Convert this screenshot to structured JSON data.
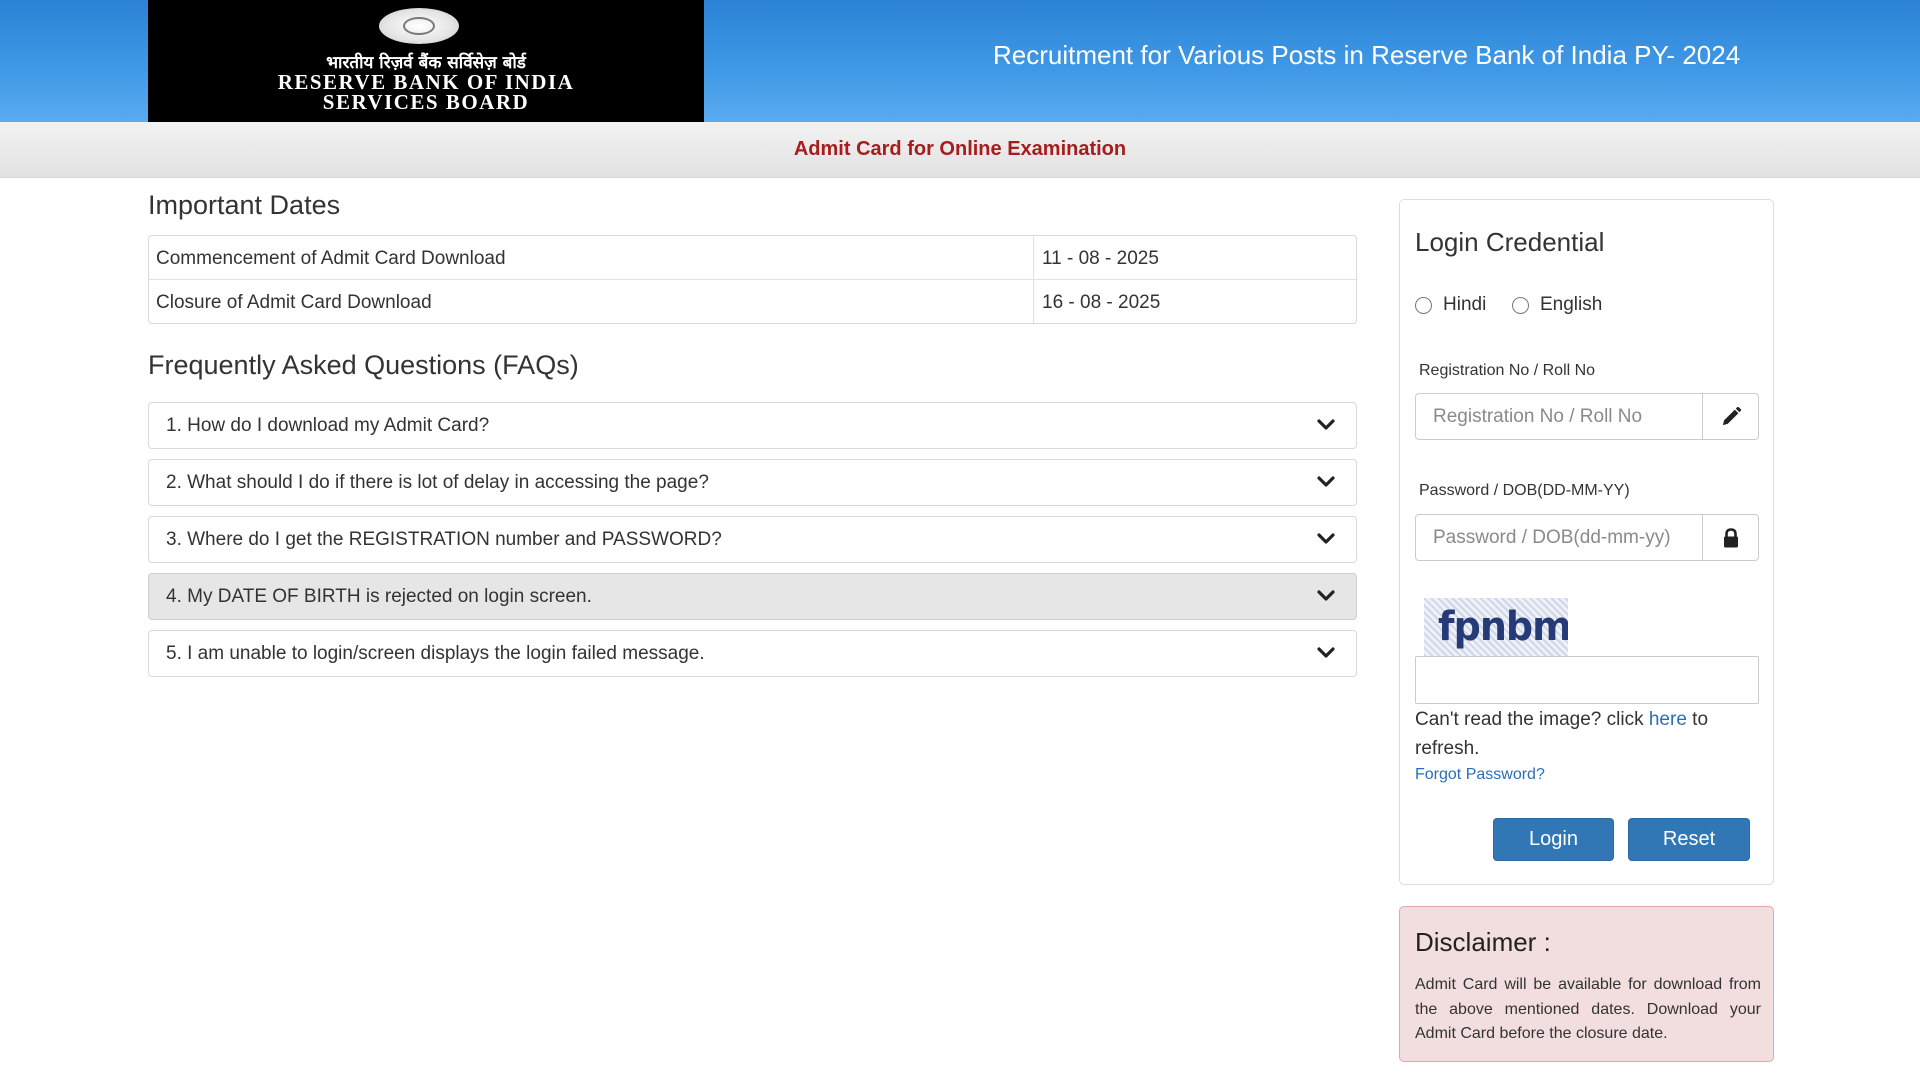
{
  "header": {
    "logo_hindi": "भारतीय रिज़र्व बैंक सर्विसेज़ बोर्ड",
    "logo_line1": "RESERVE BANK OF INDIA",
    "logo_line2": "SERVICES BOARD",
    "title": "Recruitment for Various Posts in Reserve Bank of India PY- 2024",
    "colors": {
      "header_blue": "#3f98e5",
      "logo_bg": "#000000"
    }
  },
  "subheader": {
    "title": "Admit Card for Online Examination",
    "color": "#a61d1d"
  },
  "important_dates": {
    "heading": "Important Dates",
    "rows": [
      {
        "label": "Commencement of Admit Card Download",
        "value": "11 - 08 - 2025"
      },
      {
        "label": "Closure of Admit Card Download",
        "value": "16 - 08 - 2025"
      }
    ]
  },
  "faqs": {
    "heading": "Frequently Asked Questions (FAQs)",
    "items": [
      {
        "question": "1. How do I download my Admit Card?"
      },
      {
        "question": "2. What should I do if there is lot of delay in accessing the page?"
      },
      {
        "question": "3. Where do I get the REGISTRATION number and PASSWORD?"
      },
      {
        "question": "4. My DATE OF BIRTH is rejected on login screen."
      },
      {
        "question": "5. I am unable to login/screen displays the login failed message."
      }
    ],
    "active_index": 3,
    "expand_icon": "chevron-down-icon"
  },
  "login": {
    "title": "Login Credential",
    "languages": [
      "Hindi",
      "English"
    ],
    "registration_label": "Registration No / Roll No",
    "registration_placeholder": "Registration No / Roll No",
    "registration_icon": "pencil-icon",
    "password_label": "Password / DOB(DD-MM-YY)",
    "password_placeholder": "Password / DOB(dd-mm-yy)",
    "password_icon": "lock-icon",
    "captcha_text": "fpnbm",
    "captcha_value": "",
    "help_prefix": "Can't read the image? click ",
    "help_link": "here",
    "help_suffix": " to refresh.",
    "forgot_password": "Forgot Password?",
    "login_button": "Login",
    "reset_button": "Reset",
    "button_color": "#3277b5",
    "link_color": "#2a6ebb"
  },
  "disclaimer": {
    "title": "Disclaimer :",
    "text": "Admit Card will be available for download from the above mentioned dates. Download your Admit Card before the closure date.",
    "background": "#f2dede"
  }
}
